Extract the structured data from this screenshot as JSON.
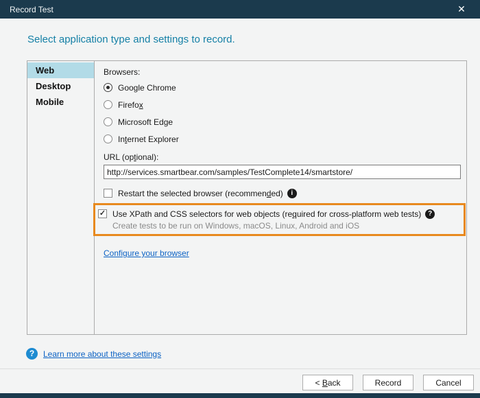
{
  "window": {
    "title": "Record Test",
    "close_glyph": "✕"
  },
  "heading": "Select application type and settings to record.",
  "sidebar": {
    "items": [
      {
        "label": "Web",
        "selected": true
      },
      {
        "label": "Desktop",
        "selected": false
      },
      {
        "label": "Mobile",
        "selected": false
      }
    ]
  },
  "content": {
    "browsers_label": "Browsers:",
    "browsers": [
      {
        "label": "Google Chrome",
        "selected": true
      },
      {
        "label": "Firefox",
        "selected": false
      },
      {
        "label": "Microsoft Edge",
        "selected": false
      },
      {
        "label": "Internet Explorer",
        "selected": false
      }
    ],
    "url_label": "URL (optional):",
    "url_value": "http://services.smartbear.com/samples/TestComplete14/smartstore/",
    "restart_checkbox": {
      "label": "Restart the selected browser (recommended)",
      "checked": false,
      "info_icon_glyph": "i"
    },
    "xpath_checkbox": {
      "label": "Use XPath and CSS selectors for web objects (required for cross-platform web tests)",
      "checked": true,
      "help_icon_glyph": "?",
      "subtext": "Create tests to be run on Windows, macOS, Linux, Android and iOS"
    },
    "configure_link": "Configure your browser"
  },
  "footer": {
    "learn_icon_glyph": "?",
    "learn_more_link": "Learn more about these settings",
    "buttons": [
      {
        "label": "< Back"
      },
      {
        "label": "Record"
      },
      {
        "label": "Cancel"
      }
    ]
  },
  "colors": {
    "titlebar": "#1b3a4d",
    "heading": "#1580a6",
    "sidebar_selected": "#b2dbe7",
    "highlight_orange": "#e8891e",
    "link_blue": "#0b62c4",
    "subtext_gray": "#8a8a8a"
  }
}
